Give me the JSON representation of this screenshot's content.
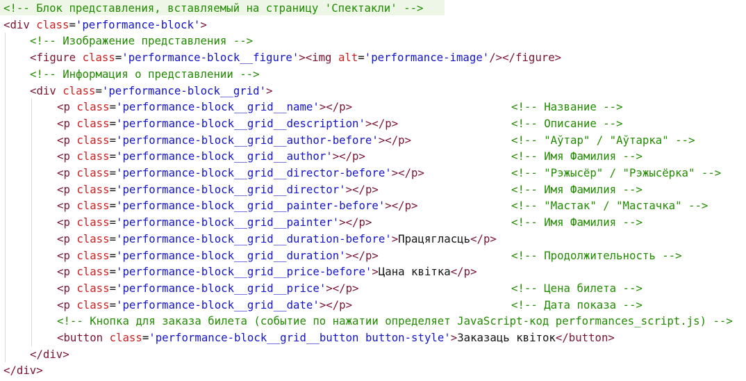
{
  "code_lines": [
    {
      "col": 0,
      "tokens": [
        {
          "t": "cm",
          "v": "<!-- Блок представления, вставляемый на страницу 'Спектакли' -->"
        }
      ]
    },
    {
      "col": 0,
      "tokens": [
        {
          "t": "tg",
          "v": "<div"
        },
        {
          "t": "tx",
          "v": " "
        },
        {
          "t": "at",
          "v": "class"
        },
        {
          "t": "pn",
          "v": "="
        },
        {
          "t": "st",
          "v": "'performance-block'"
        },
        {
          "t": "tg",
          "v": ">"
        }
      ]
    },
    {
      "col": 1,
      "tokens": [
        {
          "t": "cm",
          "v": "<!-- Изображение представления -->"
        }
      ]
    },
    {
      "col": 1,
      "tokens": [
        {
          "t": "tg",
          "v": "<figure"
        },
        {
          "t": "tx",
          "v": " "
        },
        {
          "t": "at",
          "v": "class"
        },
        {
          "t": "pn",
          "v": "="
        },
        {
          "t": "st",
          "v": "'performance-block__figure'"
        },
        {
          "t": "tg",
          "v": "><img"
        },
        {
          "t": "tx",
          "v": " "
        },
        {
          "t": "at",
          "v": "alt"
        },
        {
          "t": "pn",
          "v": "="
        },
        {
          "t": "st",
          "v": "'performance-image'"
        },
        {
          "t": "tg",
          "v": "/></figure>"
        }
      ]
    },
    {
      "col": 1,
      "tokens": [
        {
          "t": "cm",
          "v": "<!-- Информация о представлении -->"
        }
      ]
    },
    {
      "col": 1,
      "tokens": [
        {
          "t": "tg",
          "v": "<div"
        },
        {
          "t": "tx",
          "v": " "
        },
        {
          "t": "at",
          "v": "class"
        },
        {
          "t": "pn",
          "v": "="
        },
        {
          "t": "st",
          "v": "'performance-block__grid'"
        },
        {
          "t": "tg",
          "v": ">"
        }
      ]
    },
    {
      "col": 2,
      "comment": "<!-- Название -->",
      "tokens": [
        {
          "t": "tg",
          "v": "<p"
        },
        {
          "t": "tx",
          "v": " "
        },
        {
          "t": "at",
          "v": "class"
        },
        {
          "t": "pn",
          "v": "="
        },
        {
          "t": "st",
          "v": "'performance-block__grid__name'"
        },
        {
          "t": "tg",
          "v": "></p>"
        }
      ]
    },
    {
      "col": 2,
      "comment": "<!-- Описание -->",
      "tokens": [
        {
          "t": "tg",
          "v": "<p"
        },
        {
          "t": "tx",
          "v": " "
        },
        {
          "t": "at",
          "v": "class"
        },
        {
          "t": "pn",
          "v": "="
        },
        {
          "t": "st",
          "v": "'performance-block__grid__description'"
        },
        {
          "t": "tg",
          "v": "></p>"
        }
      ]
    },
    {
      "col": 2,
      "comment": "<!-- \"Аўтар\" / \"Аўтарка\" -->",
      "tokens": [
        {
          "t": "tg",
          "v": "<p"
        },
        {
          "t": "tx",
          "v": " "
        },
        {
          "t": "at",
          "v": "class"
        },
        {
          "t": "pn",
          "v": "="
        },
        {
          "t": "st",
          "v": "'performance-block__grid__author-before'"
        },
        {
          "t": "tg",
          "v": "></p>"
        }
      ]
    },
    {
      "col": 2,
      "comment": "<!-- Имя Фамилия -->",
      "tokens": [
        {
          "t": "tg",
          "v": "<p"
        },
        {
          "t": "tx",
          "v": " "
        },
        {
          "t": "at",
          "v": "class"
        },
        {
          "t": "pn",
          "v": "="
        },
        {
          "t": "st",
          "v": "'performance-block__grid__author'"
        },
        {
          "t": "tg",
          "v": "></p>"
        }
      ]
    },
    {
      "col": 2,
      "comment": "<!-- \"Рэжысёр\" / \"Рэжысёрка\" -->",
      "tokens": [
        {
          "t": "tg",
          "v": "<p"
        },
        {
          "t": "tx",
          "v": " "
        },
        {
          "t": "at",
          "v": "class"
        },
        {
          "t": "pn",
          "v": "="
        },
        {
          "t": "st",
          "v": "'performance-block__grid__director-before'"
        },
        {
          "t": "tg",
          "v": "></p>"
        }
      ]
    },
    {
      "col": 2,
      "comment": "<!-- Имя Фамилия -->",
      "tokens": [
        {
          "t": "tg",
          "v": "<p"
        },
        {
          "t": "tx",
          "v": " "
        },
        {
          "t": "at",
          "v": "class"
        },
        {
          "t": "pn",
          "v": "="
        },
        {
          "t": "st",
          "v": "'performance-block__grid__director'"
        },
        {
          "t": "tg",
          "v": "></p>"
        }
      ]
    },
    {
      "col": 2,
      "comment": "<!-- \"Мастак\" / \"Мастачка\" -->",
      "tokens": [
        {
          "t": "tg",
          "v": "<p"
        },
        {
          "t": "tx",
          "v": " "
        },
        {
          "t": "at",
          "v": "class"
        },
        {
          "t": "pn",
          "v": "="
        },
        {
          "t": "st",
          "v": "'performance-block__grid__painter-before'"
        },
        {
          "t": "tg",
          "v": "></p>"
        }
      ]
    },
    {
      "col": 2,
      "comment": "<!-- Имя Фамилия -->",
      "tokens": [
        {
          "t": "tg",
          "v": "<p"
        },
        {
          "t": "tx",
          "v": " "
        },
        {
          "t": "at",
          "v": "class"
        },
        {
          "t": "pn",
          "v": "="
        },
        {
          "t": "st",
          "v": "'performance-block__grid__painter'"
        },
        {
          "t": "tg",
          "v": "></p>"
        }
      ]
    },
    {
      "col": 2,
      "tokens": [
        {
          "t": "tg",
          "v": "<p"
        },
        {
          "t": "tx",
          "v": " "
        },
        {
          "t": "at",
          "v": "class"
        },
        {
          "t": "pn",
          "v": "="
        },
        {
          "t": "st",
          "v": "'performance-block__grid__duration-before'"
        },
        {
          "t": "tg",
          "v": ">"
        },
        {
          "t": "tx",
          "v": "Працягласць"
        },
        {
          "t": "tg",
          "v": "</p>"
        }
      ]
    },
    {
      "col": 2,
      "comment": "<!-- Продолжительность -->",
      "tokens": [
        {
          "t": "tg",
          "v": "<p"
        },
        {
          "t": "tx",
          "v": " "
        },
        {
          "t": "at",
          "v": "class"
        },
        {
          "t": "pn",
          "v": "="
        },
        {
          "t": "st",
          "v": "'performance-block__grid__duration'"
        },
        {
          "t": "tg",
          "v": "></p>"
        }
      ]
    },
    {
      "col": 2,
      "tokens": [
        {
          "t": "tg",
          "v": "<p"
        },
        {
          "t": "tx",
          "v": " "
        },
        {
          "t": "at",
          "v": "class"
        },
        {
          "t": "pn",
          "v": "="
        },
        {
          "t": "st",
          "v": "'performance-block__grid__price-before'"
        },
        {
          "t": "tg",
          "v": ">"
        },
        {
          "t": "tx",
          "v": "Цана квітка"
        },
        {
          "t": "tg",
          "v": "</p>"
        }
      ]
    },
    {
      "col": 2,
      "comment": "<!-- Цена билета -->",
      "tokens": [
        {
          "t": "tg",
          "v": "<p"
        },
        {
          "t": "tx",
          "v": " "
        },
        {
          "t": "at",
          "v": "class"
        },
        {
          "t": "pn",
          "v": "="
        },
        {
          "t": "st",
          "v": "'performance-block__grid__price'"
        },
        {
          "t": "tg",
          "v": "></p>"
        }
      ]
    },
    {
      "col": 2,
      "comment": "<!-- Дата показа -->",
      "tokens": [
        {
          "t": "tg",
          "v": "<p"
        },
        {
          "t": "tx",
          "v": " "
        },
        {
          "t": "at",
          "v": "class"
        },
        {
          "t": "pn",
          "v": "="
        },
        {
          "t": "st",
          "v": "'performance-block__grid__date'"
        },
        {
          "t": "tg",
          "v": "></p>"
        }
      ]
    },
    {
      "col": 2,
      "tokens": [
        {
          "t": "cm",
          "v": "<!-- Кнопка для заказа билета (событие по нажатии определяет JavaScript-код performances_script.js) -->"
        }
      ]
    },
    {
      "col": 2,
      "tokens": [
        {
          "t": "tg",
          "v": "<button"
        },
        {
          "t": "tx",
          "v": " "
        },
        {
          "t": "at",
          "v": "class"
        },
        {
          "t": "pn",
          "v": "="
        },
        {
          "t": "st",
          "v": "'performance-block__grid__button button-style'"
        },
        {
          "t": "tg",
          "v": ">"
        },
        {
          "t": "tx",
          "v": "Заказаць квіток"
        },
        {
          "t": "tg",
          "v": "</button>"
        }
      ]
    },
    {
      "col": 1,
      "tokens": [
        {
          "t": "tg",
          "v": "</div>"
        }
      ]
    },
    {
      "col": 0,
      "tokens": [
        {
          "t": "tg",
          "v": "</div>"
        }
      ]
    }
  ],
  "colors": {
    "comment": "#218b00",
    "tag": "#7a1230",
    "attribute": "#cc1f1f",
    "string": "#1313c9",
    "text": "#111111",
    "indent_guide": "#d9d9d9",
    "background": "#ffffff"
  }
}
